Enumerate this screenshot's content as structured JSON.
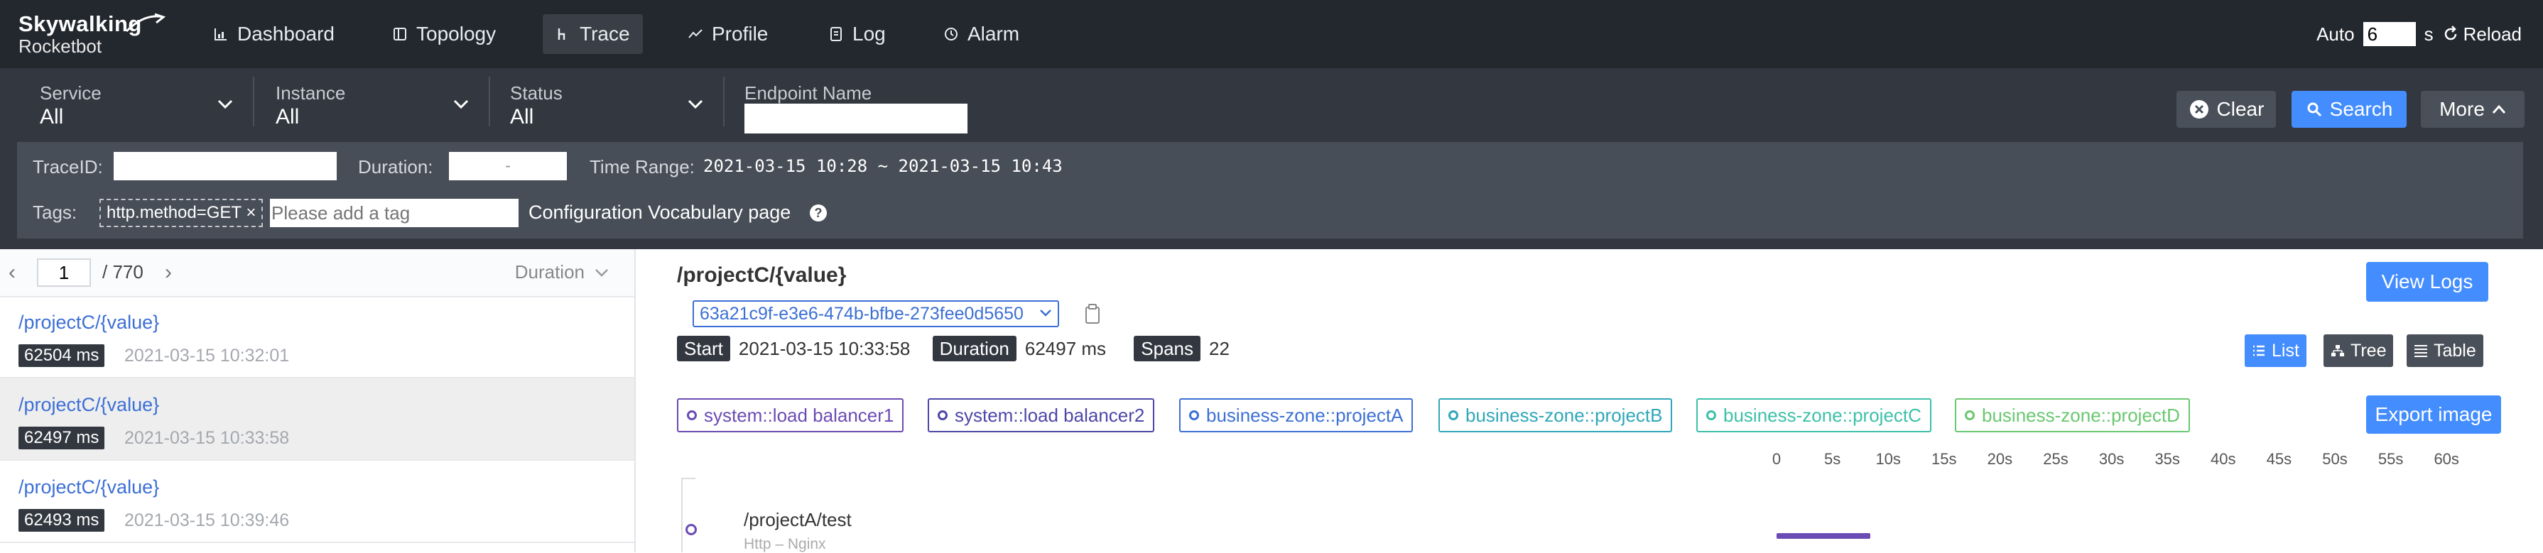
{
  "brand": {
    "line1": "Skywalking",
    "line2": "Rocketbot"
  },
  "nav": [
    {
      "label": "Dashboard",
      "icon": "bar-chart-icon"
    },
    {
      "label": "Topology",
      "icon": "topology-icon"
    },
    {
      "label": "Trace",
      "icon": "trace-icon",
      "active": true
    },
    {
      "label": "Profile",
      "icon": "profile-icon"
    },
    {
      "label": "Log",
      "icon": "log-icon"
    },
    {
      "label": "Alarm",
      "icon": "alarm-icon"
    }
  ],
  "auto": {
    "label": "Auto",
    "interval": "6",
    "unit": "s",
    "reload_label": "Reload"
  },
  "filters": {
    "service": {
      "label": "Service",
      "value": "All"
    },
    "instance": {
      "label": "Instance",
      "value": "All"
    },
    "status": {
      "label": "Status",
      "value": "All"
    },
    "endpoint": {
      "label": "Endpoint Name",
      "value": ""
    },
    "clear_label": "Clear",
    "search_label": "Search",
    "more_label": "More",
    "traceid_label": "TraceID:",
    "duration_label": "Duration:",
    "duration_sep": "-",
    "time_range_label": "Time Range:",
    "time_range_value": "2021-03-15 10:28 ~ 2021-03-15 10:43",
    "tags_label": "Tags:",
    "tag_chip": "http.method=GET",
    "tag_remove": "×",
    "tag_placeholder": "Please add a tag",
    "vocab_label": "Configuration Vocabulary page"
  },
  "pager": {
    "page": "1",
    "total": "/ 770",
    "sort_label": "Duration"
  },
  "traces": [
    {
      "endpoint": "/projectC/{value}",
      "duration": "62504 ms",
      "time": "2021-03-15 10:32:01",
      "selected": false
    },
    {
      "endpoint": "/projectC/{value}",
      "duration": "62497 ms",
      "time": "2021-03-15 10:33:58",
      "selected": true
    },
    {
      "endpoint": "/projectC/{value}",
      "duration": "62493 ms",
      "time": "2021-03-15 10:39:46",
      "selected": false
    }
  ],
  "detail": {
    "title": "/projectC/{value}",
    "trace_id": "63a21c9f-e3e6-474b-bfbe-273fee0d5650",
    "start_label": "Start",
    "start_value": "2021-03-15 10:33:58",
    "duration_label": "Duration",
    "duration_value": "62497 ms",
    "spans_label": "Spans",
    "spans_value": "22",
    "view_logs_label": "View Logs",
    "list_label": "List",
    "tree_label": "Tree",
    "table_label": "Table",
    "export_label": "Export image",
    "services": [
      {
        "name": "system::load balancer1",
        "color": "#6b4bb4"
      },
      {
        "name": "system::load balancer2",
        "color": "#4e46a8"
      },
      {
        "name": "business-zone::projectA",
        "color": "#3c6fd6"
      },
      {
        "name": "business-zone::projectB",
        "color": "#2fa7b8"
      },
      {
        "name": "business-zone::projectC",
        "color": "#3cc0a8"
      },
      {
        "name": "business-zone::projectD",
        "color": "#69c870"
      }
    ],
    "axis": [
      "0",
      "5s",
      "10s",
      "15s",
      "20s",
      "25s",
      "30s",
      "35s",
      "40s",
      "45s",
      "50s",
      "55s",
      "60s"
    ],
    "span": {
      "name": "/projectA/test",
      "sub": "Http – Nginx"
    }
  }
}
